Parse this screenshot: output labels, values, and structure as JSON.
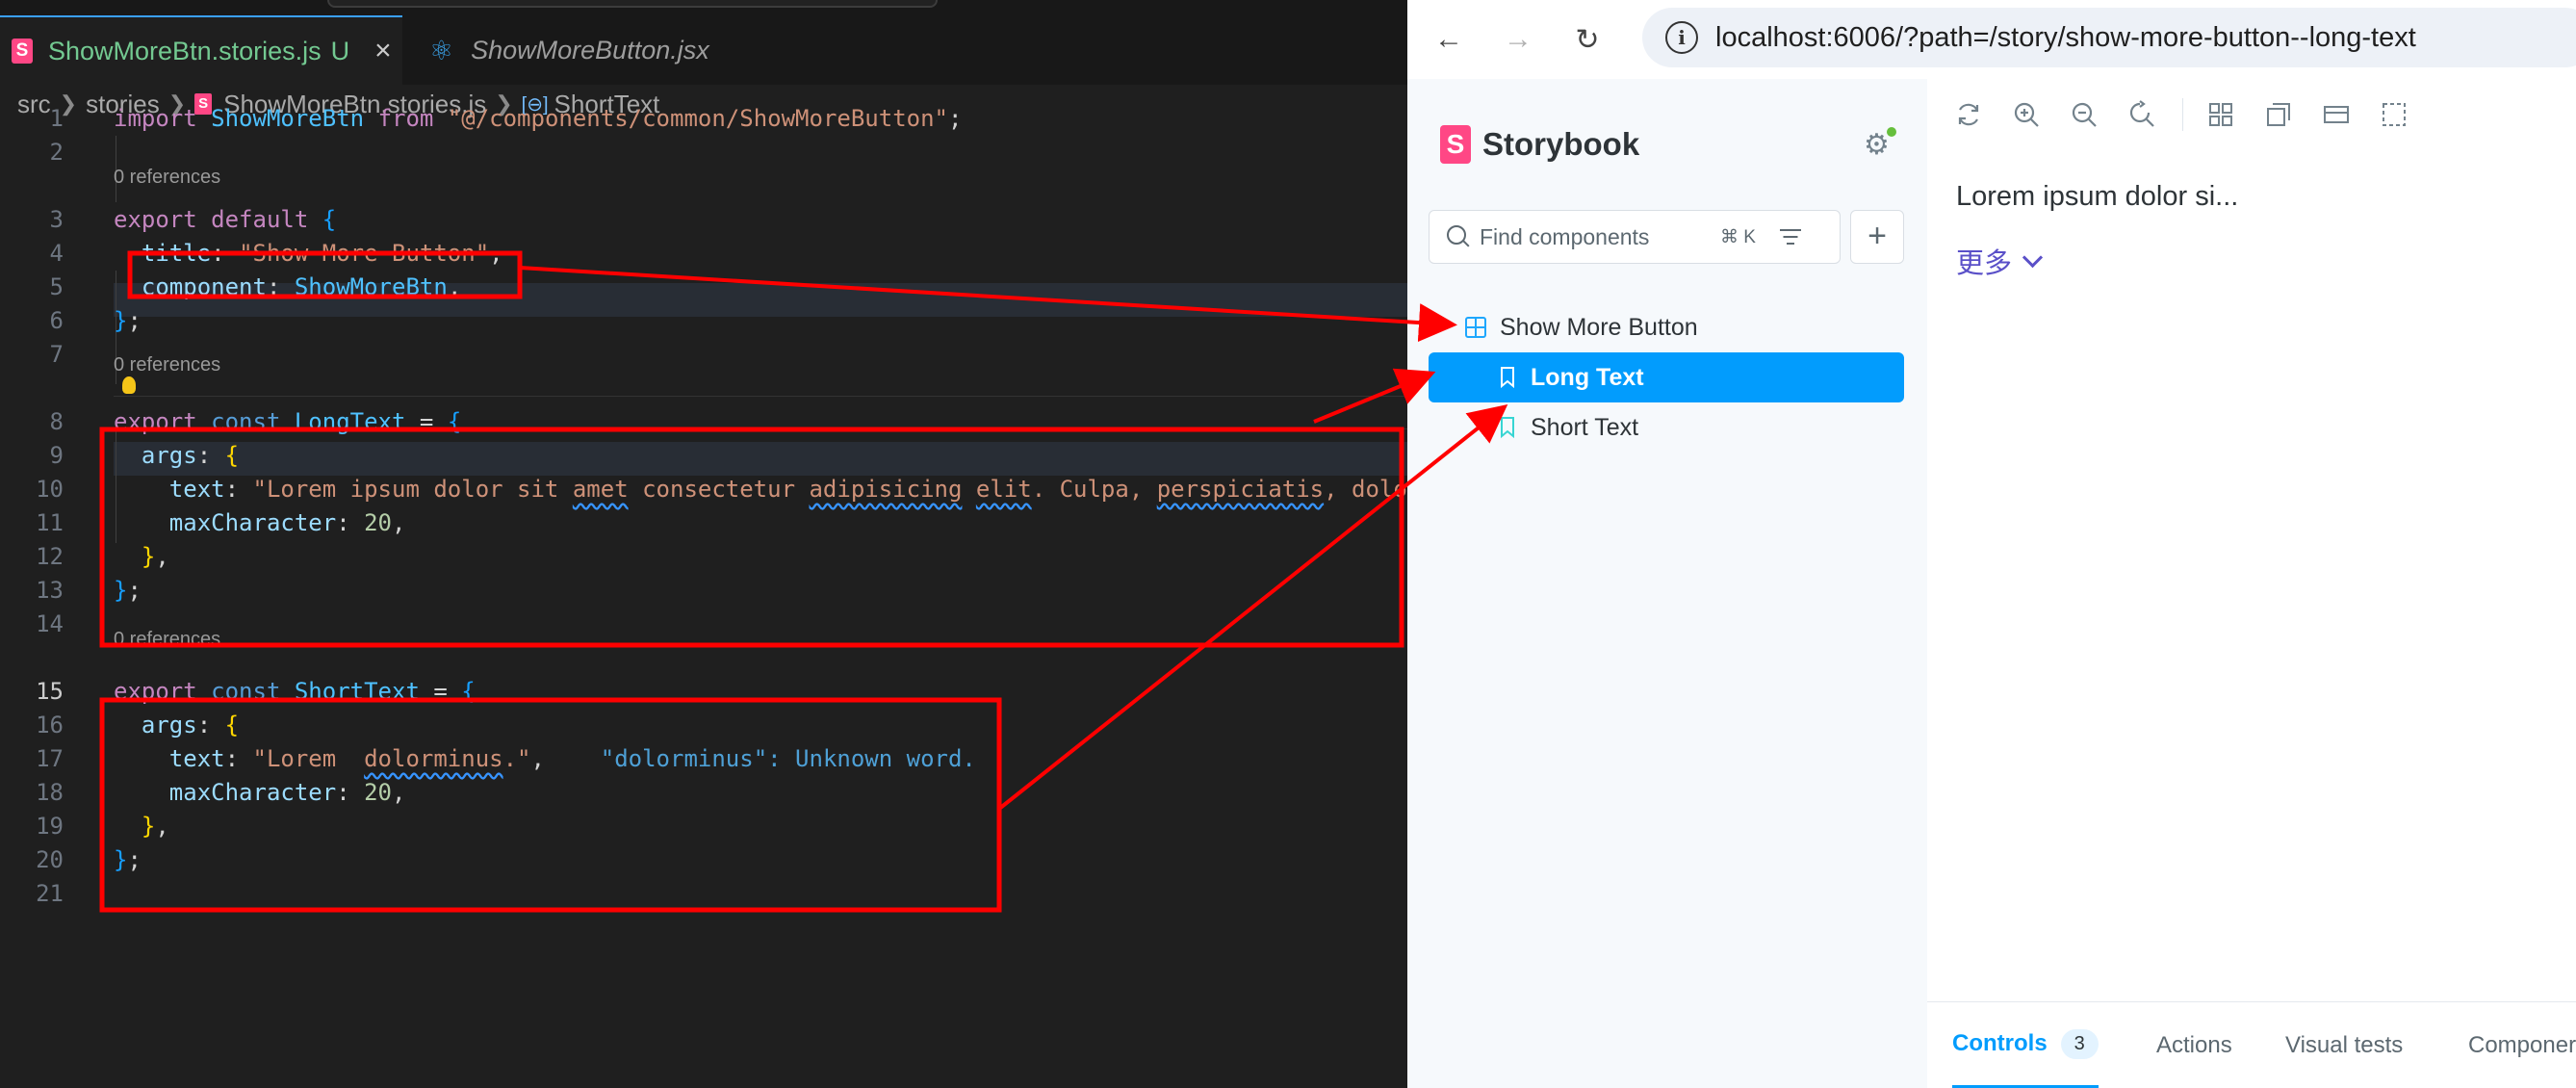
{
  "editor": {
    "tabs": [
      {
        "label": "ShowMoreBtn.stories.js",
        "badge": "U"
      },
      {
        "label": "ShowMoreButton.jsx"
      }
    ],
    "breadcrumb": [
      "src",
      "stories",
      "ShowMoreBtn.stories.js",
      "ShortText"
    ],
    "code_lens": "0 references",
    "line_numbers": [
      "1",
      "2",
      "3",
      "4",
      "5",
      "6",
      "7",
      "8",
      "9",
      "10",
      "11",
      "12",
      "13",
      "14",
      "15",
      "16",
      "17",
      "18",
      "19",
      "20",
      "21"
    ],
    "code": {
      "l1": {
        "k1": "import",
        "k2": "ShowMoreBtn",
        "k3": "from",
        "k4": "\"@/components/common/ShowMoreButton\"",
        "k5": ";"
      },
      "l3": {
        "k1": "export",
        "k2": "default",
        "k3": "{"
      },
      "l4": {
        "k1": "title",
        "k2": ": ",
        "k3": "\"Show More Button\"",
        "k4": ","
      },
      "l5": {
        "k1": "component",
        "k2": ": ",
        "k3": "ShowMoreBtn",
        "k4": ","
      },
      "l6": {
        "k1": "}",
        "k2": ";"
      },
      "l8": {
        "k1": "export",
        "k2": "const",
        "k3": "LongText",
        "k4": " = ",
        "k5": "{"
      },
      "l9": {
        "k1": "args",
        "k2": ": ",
        "k3": "{"
      },
      "l10": {
        "k1": "text",
        "k2": ": ",
        "s1": "\"Lorem ipsum dolor sit ",
        "s2": "amet",
        "s3": " consectetur ",
        "s4": "adipisicing",
        "s5": " ",
        "s6": "elit",
        "s7": ". Culpa, ",
        "s8": "perspiciatis",
        "s9": ", dolo"
      },
      "l11": {
        "k1": "maxCharacter",
        "k2": ": ",
        "k3": "20",
        "k4": ","
      },
      "l12": {
        "k1": "}",
        "k2": ","
      },
      "l13": {
        "k1": "}",
        "k2": ";"
      },
      "l15": {
        "k1": "export",
        "k2": "const",
        "k3": "ShortText",
        "k4": " = ",
        "k5": "{"
      },
      "l16": {
        "k1": "args",
        "k2": ": ",
        "k3": "{"
      },
      "l17": {
        "k1": "text",
        "k2": ": ",
        "s1": "\"Lorem  ",
        "s2": "dolorminus",
        "s3": ".\"",
        "k3": ",",
        "hint": "\"dolorminus\": Unknown word."
      },
      "l18": {
        "k1": "maxCharacter",
        "k2": ": ",
        "k3": "20",
        "k4": ","
      },
      "l19": {
        "k1": "}",
        "k2": ","
      },
      "l20": {
        "k1": "}",
        "k2": ";"
      }
    }
  },
  "browser": {
    "url": "localhost:6006/?path=/story/show-more-button--long-text",
    "storybook": {
      "brand": "Storybook",
      "search_placeholder": "Find components",
      "search_shortcut": "⌘ K",
      "tree": [
        {
          "label": "Show More Button",
          "kind": "component"
        },
        {
          "label": "Long Text",
          "kind": "story",
          "selected": true
        },
        {
          "label": "Short Text",
          "kind": "story"
        }
      ],
      "preview": {
        "text": "Lorem ipsum dolor si...",
        "more_label": "更多"
      },
      "addons": [
        {
          "label": "Controls",
          "badge": "3",
          "active": true
        },
        {
          "label": "Actions"
        },
        {
          "label": "Visual tests"
        },
        {
          "label": "Componer"
        }
      ]
    }
  },
  "annotation_color": "#ff0000"
}
